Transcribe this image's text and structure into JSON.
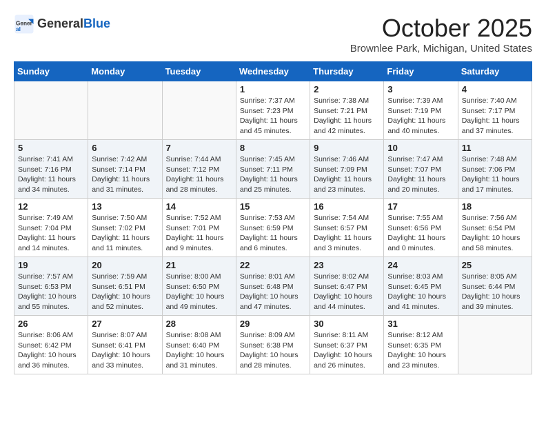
{
  "header": {
    "logo_general": "General",
    "logo_blue": "Blue",
    "month_title": "October 2025",
    "location": "Brownlee Park, Michigan, United States"
  },
  "days_of_week": [
    "Sunday",
    "Monday",
    "Tuesday",
    "Wednesday",
    "Thursday",
    "Friday",
    "Saturday"
  ],
  "weeks": [
    [
      {
        "day": "",
        "info": ""
      },
      {
        "day": "",
        "info": ""
      },
      {
        "day": "",
        "info": ""
      },
      {
        "day": "1",
        "info": "Sunrise: 7:37 AM\nSunset: 7:23 PM\nDaylight: 11 hours and 45 minutes."
      },
      {
        "day": "2",
        "info": "Sunrise: 7:38 AM\nSunset: 7:21 PM\nDaylight: 11 hours and 42 minutes."
      },
      {
        "day": "3",
        "info": "Sunrise: 7:39 AM\nSunset: 7:19 PM\nDaylight: 11 hours and 40 minutes."
      },
      {
        "day": "4",
        "info": "Sunrise: 7:40 AM\nSunset: 7:17 PM\nDaylight: 11 hours and 37 minutes."
      }
    ],
    [
      {
        "day": "5",
        "info": "Sunrise: 7:41 AM\nSunset: 7:16 PM\nDaylight: 11 hours and 34 minutes."
      },
      {
        "day": "6",
        "info": "Sunrise: 7:42 AM\nSunset: 7:14 PM\nDaylight: 11 hours and 31 minutes."
      },
      {
        "day": "7",
        "info": "Sunrise: 7:44 AM\nSunset: 7:12 PM\nDaylight: 11 hours and 28 minutes."
      },
      {
        "day": "8",
        "info": "Sunrise: 7:45 AM\nSunset: 7:11 PM\nDaylight: 11 hours and 25 minutes."
      },
      {
        "day": "9",
        "info": "Sunrise: 7:46 AM\nSunset: 7:09 PM\nDaylight: 11 hours and 23 minutes."
      },
      {
        "day": "10",
        "info": "Sunrise: 7:47 AM\nSunset: 7:07 PM\nDaylight: 11 hours and 20 minutes."
      },
      {
        "day": "11",
        "info": "Sunrise: 7:48 AM\nSunset: 7:06 PM\nDaylight: 11 hours and 17 minutes."
      }
    ],
    [
      {
        "day": "12",
        "info": "Sunrise: 7:49 AM\nSunset: 7:04 PM\nDaylight: 11 hours and 14 minutes."
      },
      {
        "day": "13",
        "info": "Sunrise: 7:50 AM\nSunset: 7:02 PM\nDaylight: 11 hours and 11 minutes."
      },
      {
        "day": "14",
        "info": "Sunrise: 7:52 AM\nSunset: 7:01 PM\nDaylight: 11 hours and 9 minutes."
      },
      {
        "day": "15",
        "info": "Sunrise: 7:53 AM\nSunset: 6:59 PM\nDaylight: 11 hours and 6 minutes."
      },
      {
        "day": "16",
        "info": "Sunrise: 7:54 AM\nSunset: 6:57 PM\nDaylight: 11 hours and 3 minutes."
      },
      {
        "day": "17",
        "info": "Sunrise: 7:55 AM\nSunset: 6:56 PM\nDaylight: 11 hours and 0 minutes."
      },
      {
        "day": "18",
        "info": "Sunrise: 7:56 AM\nSunset: 6:54 PM\nDaylight: 10 hours and 58 minutes."
      }
    ],
    [
      {
        "day": "19",
        "info": "Sunrise: 7:57 AM\nSunset: 6:53 PM\nDaylight: 10 hours and 55 minutes."
      },
      {
        "day": "20",
        "info": "Sunrise: 7:59 AM\nSunset: 6:51 PM\nDaylight: 10 hours and 52 minutes."
      },
      {
        "day": "21",
        "info": "Sunrise: 8:00 AM\nSunset: 6:50 PM\nDaylight: 10 hours and 49 minutes."
      },
      {
        "day": "22",
        "info": "Sunrise: 8:01 AM\nSunset: 6:48 PM\nDaylight: 10 hours and 47 minutes."
      },
      {
        "day": "23",
        "info": "Sunrise: 8:02 AM\nSunset: 6:47 PM\nDaylight: 10 hours and 44 minutes."
      },
      {
        "day": "24",
        "info": "Sunrise: 8:03 AM\nSunset: 6:45 PM\nDaylight: 10 hours and 41 minutes."
      },
      {
        "day": "25",
        "info": "Sunrise: 8:05 AM\nSunset: 6:44 PM\nDaylight: 10 hours and 39 minutes."
      }
    ],
    [
      {
        "day": "26",
        "info": "Sunrise: 8:06 AM\nSunset: 6:42 PM\nDaylight: 10 hours and 36 minutes."
      },
      {
        "day": "27",
        "info": "Sunrise: 8:07 AM\nSunset: 6:41 PM\nDaylight: 10 hours and 33 minutes."
      },
      {
        "day": "28",
        "info": "Sunrise: 8:08 AM\nSunset: 6:40 PM\nDaylight: 10 hours and 31 minutes."
      },
      {
        "day": "29",
        "info": "Sunrise: 8:09 AM\nSunset: 6:38 PM\nDaylight: 10 hours and 28 minutes."
      },
      {
        "day": "30",
        "info": "Sunrise: 8:11 AM\nSunset: 6:37 PM\nDaylight: 10 hours and 26 minutes."
      },
      {
        "day": "31",
        "info": "Sunrise: 8:12 AM\nSunset: 6:35 PM\nDaylight: 10 hours and 23 minutes."
      },
      {
        "day": "",
        "info": ""
      }
    ]
  ]
}
